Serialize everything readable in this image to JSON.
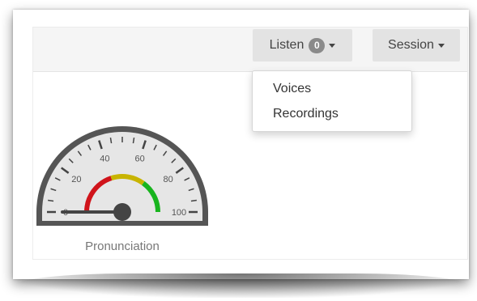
{
  "navbar": {
    "listen": {
      "label": "Listen",
      "badge": "0"
    },
    "session": {
      "label": "Session"
    }
  },
  "listen_menu": {
    "items": [
      {
        "label": "Voices"
      },
      {
        "label": "Recordings"
      }
    ]
  },
  "gauge": {
    "title": "Pronunciation",
    "min": 0,
    "max": 100,
    "value": 0,
    "major_ticks": [
      "0",
      "20",
      "40",
      "60",
      "80",
      "100"
    ],
    "bands": [
      {
        "from": 0,
        "to": 40,
        "color": "#d0141b"
      },
      {
        "from": 40,
        "to": 70,
        "color": "#c8b400"
      },
      {
        "from": 70,
        "to": 100,
        "color": "#18b41e"
      }
    ]
  }
}
